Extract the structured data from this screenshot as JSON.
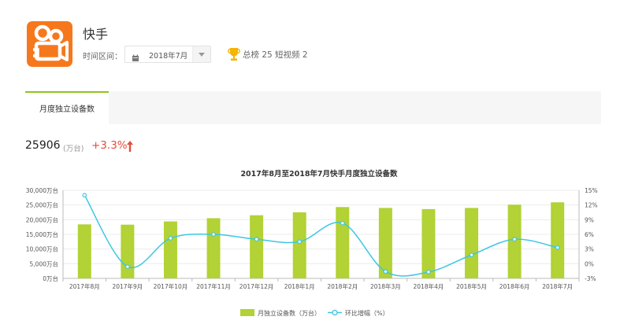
{
  "app": {
    "name": "快手",
    "icon": "kuaishou-camera-logo-icon"
  },
  "filters": {
    "period_label": "时间区间：",
    "period_value": "2018年7月",
    "calendar_icon": "calendar-icon",
    "dropdown_icon": "chevron-down-icon"
  },
  "ranking": {
    "icon": "trophy-icon",
    "text": "总榜 25  短视频 2"
  },
  "tabs": [
    {
      "label": "月度独立设备数",
      "active": true
    }
  ],
  "summary": {
    "value": "25906",
    "unit": "(万台)",
    "change": "+3.3%",
    "change_icon": "arrow-up-icon"
  },
  "colors": {
    "accent": "#8fc31f",
    "bar": "#b2d235",
    "line": "#3ec6e4",
    "up": "#e64b3b",
    "logo": "#f6781c"
  },
  "chart_data": {
    "type": "bar",
    "title": "2017年8月至2018年7月快手月度独立设备数",
    "categories": [
      "2017年8月",
      "2017年9月",
      "2017年10月",
      "2017年11月",
      "2017年12月",
      "2018年1月",
      "2018年2月",
      "2018年3月",
      "2018年4月",
      "2018年5月",
      "2018年6月",
      "2018年7月"
    ],
    "series": [
      {
        "name": "月独立设备数（万台）",
        "type": "bar",
        "axis": "left",
        "values": [
          18400,
          18300,
          19400,
          20500,
          21500,
          22500,
          24300,
          24000,
          23600,
          24000,
          25100,
          25906
        ]
      },
      {
        "name": "环比增幅（%）",
        "type": "line",
        "axis": "right",
        "values": [
          14,
          -0.6,
          5.2,
          6.0,
          5.0,
          4.5,
          8.3,
          -1.6,
          -1.7,
          1.8,
          5.0,
          3.3
        ]
      }
    ],
    "y_left": {
      "ticks": [
        "0万台",
        "5,000万台",
        "10,000万台",
        "15,000万台",
        "20,000万台",
        "25,000万台",
        "30,000万台"
      ],
      "min": 0,
      "max": 30000,
      "step": 5000
    },
    "y_right": {
      "ticks": [
        "-3%",
        "0%",
        "3%",
        "6%",
        "9%",
        "12%",
        "15%"
      ],
      "min": -3,
      "max": 15,
      "step": 3
    },
    "grid": true,
    "legend": "bottom-center"
  }
}
